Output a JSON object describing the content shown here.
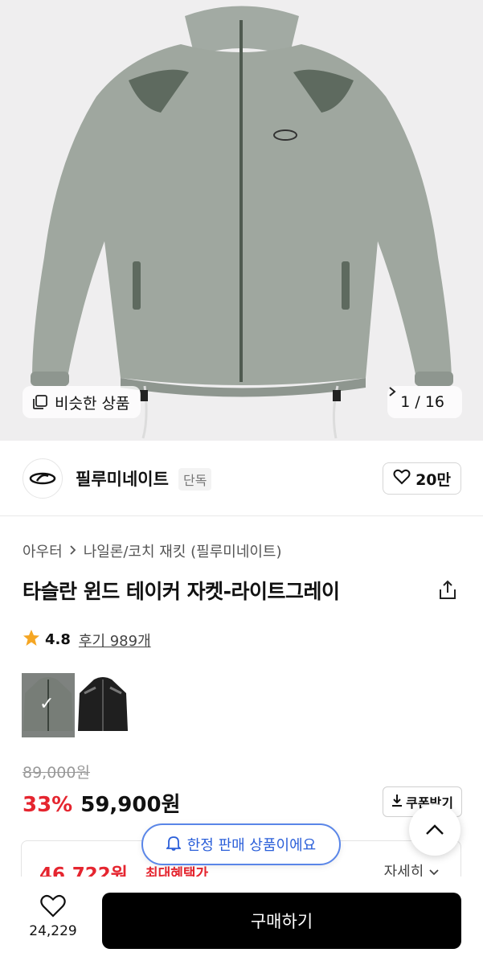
{
  "gallery": {
    "similar_label": "비슷한 상품",
    "counter": "1 / 16"
  },
  "brand": {
    "name": "필루미네이트",
    "badge": "단독",
    "like_count": "20만"
  },
  "product": {
    "breadcrumb": [
      "아우터",
      "나일론/코치 재킷 (필루미네이트)"
    ],
    "title": "타슬란 윈드 테이커 자켓-라이트그레이",
    "rating": "4.8",
    "reviews": "후기 989개",
    "swatches": [
      "라이트그레이",
      "블랙"
    ],
    "original_price": "89,000원",
    "discount": "33%",
    "price": "59,900원",
    "coupon_label": "쿠폰받기"
  },
  "benefit": {
    "best_price": "46,722원",
    "best_label": "최대혜택가",
    "detail_link": "자세히"
  },
  "toast": {
    "text": "한정 판매 상품이에요"
  },
  "bottom_bar": {
    "wish_count": "24,229",
    "buy_label": "구매하기"
  },
  "colors": {
    "accent_red": "#e5252f",
    "toast_blue": "#2b5fd9",
    "jacket": "#9fa79f"
  }
}
